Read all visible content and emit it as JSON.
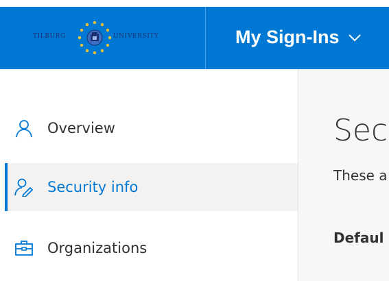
{
  "header": {
    "background": "#0078d4",
    "logo": {
      "left_word": "TILBURG",
      "right_word": "UNIVERSITY",
      "text_color": "#1c2f70",
      "star_color": "#f2c230"
    },
    "app_title": "My Sign-Ins",
    "app_title_icon": "chevron-down-icon"
  },
  "sidebar": {
    "items": [
      {
        "label": "Overview",
        "icon": "person-icon",
        "selected": false
      },
      {
        "label": "Security info",
        "icon": "person-key-icon",
        "selected": true
      },
      {
        "label": "Organizations",
        "icon": "briefcase-icon",
        "selected": false
      }
    ],
    "selected_color": "#0078d4"
  },
  "main": {
    "title": "Sec",
    "description": "These a",
    "default_label": "Defaul"
  }
}
